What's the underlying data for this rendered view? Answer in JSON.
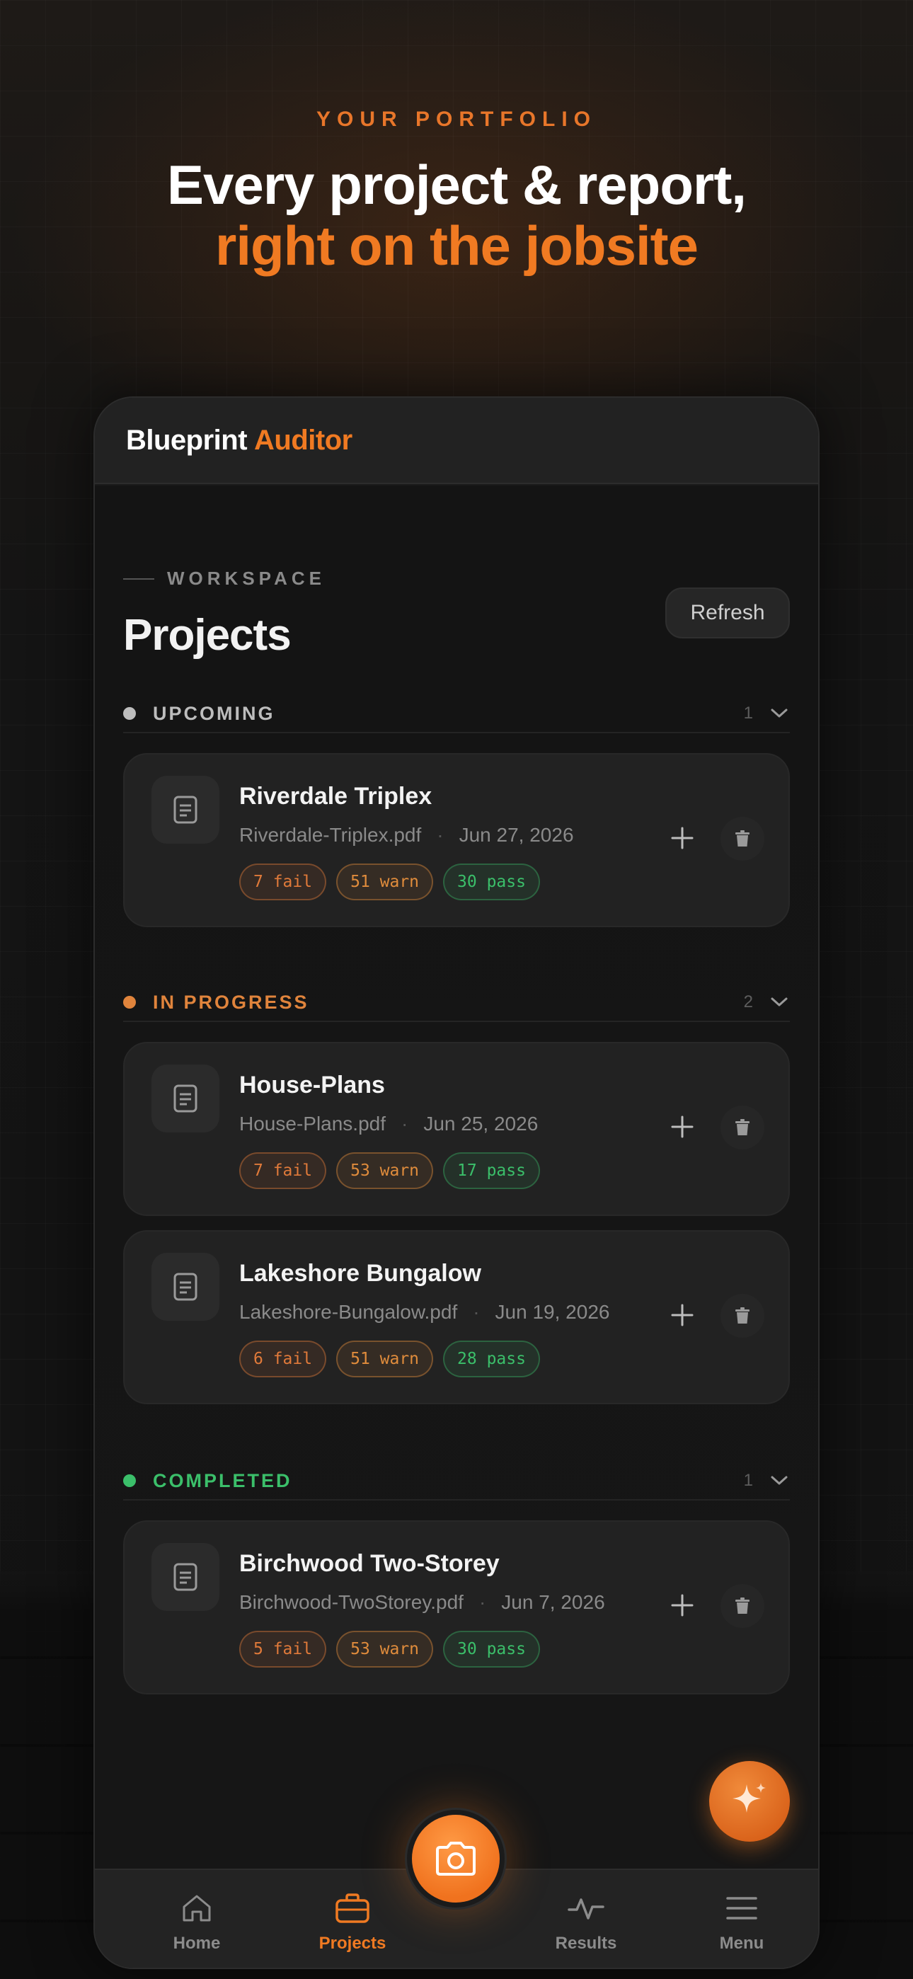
{
  "hero": {
    "eyebrow": "YOUR PORTFOLIO",
    "headline_line1": "Every project & report,",
    "headline_line2": "right on the jobsite"
  },
  "app": {
    "brand_part1": "Blueprint",
    "brand_part2": "Auditor",
    "accent_color": "#f07a22"
  },
  "page": {
    "eyebrow": "WORKSPACE",
    "title": "Projects",
    "refresh_label": "Refresh"
  },
  "sections": [
    {
      "label": "UPCOMING",
      "count": "1",
      "color": "#bdbdbd",
      "projects": [
        {
          "name": "Riverdale Triplex",
          "file": "Riverdale-Triplex.pdf",
          "date": "Jun 27, 2026",
          "fail": "7 fail",
          "warn": "51 warn",
          "pass": "30 pass"
        }
      ]
    },
    {
      "label": "IN PROGRESS",
      "count": "2",
      "color": "#e0843c",
      "projects": [
        {
          "name": "House-Plans",
          "file": "House-Plans.pdf",
          "date": "Jun 25, 2026",
          "fail": "7 fail",
          "warn": "53 warn",
          "pass": "17 pass"
        },
        {
          "name": "Lakeshore Bungalow",
          "file": "Lakeshore-Bungalow.pdf",
          "date": "Jun 19, 2026",
          "fail": "6 fail",
          "warn": "51 warn",
          "pass": "28 pass"
        }
      ]
    },
    {
      "label": "COMPLETED",
      "count": "1",
      "color": "#3bbf6a",
      "projects": [
        {
          "name": "Birchwood Two-Storey",
          "file": "Birchwood-TwoStorey.pdf",
          "date": "Jun 7, 2026",
          "fail": "5 fail",
          "warn": "53 warn",
          "pass": "30 pass"
        }
      ]
    }
  ],
  "tabs": {
    "home": "Home",
    "projects": "Projects",
    "results": "Results",
    "menu": "Menu",
    "active": "projects"
  },
  "icons": {
    "card": "document-icon",
    "add": "plus-icon",
    "delete": "trash-icon",
    "fab": "sparkle-icon",
    "camera": "camera-icon"
  }
}
